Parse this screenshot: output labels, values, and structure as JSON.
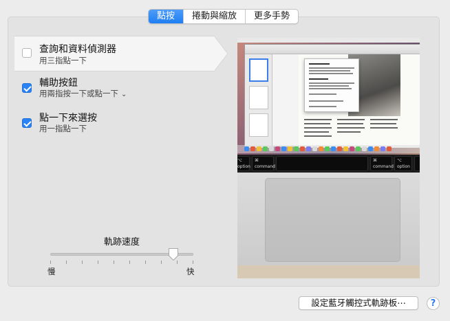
{
  "tabs": [
    {
      "label": "點按",
      "active": true
    },
    {
      "label": "捲動與縮放",
      "active": false
    },
    {
      "label": "更多手勢",
      "active": false
    }
  ],
  "options": [
    {
      "title": "查詢和資料偵測器",
      "subtitle": "用三指點一下",
      "checked": false,
      "selected": true
    },
    {
      "title": "輔助按鈕",
      "subtitle": "用兩指按一下或點一下",
      "checked": true,
      "selected": false,
      "has_dropdown": true
    },
    {
      "title": "點一下來選按",
      "subtitle": "用一指點一下",
      "checked": true,
      "selected": false
    }
  ],
  "tracking": {
    "label": "軌跡速度",
    "min_label": "慢",
    "max_label": "快",
    "value_fraction": 0.86,
    "ticks": 10
  },
  "preview": {
    "keyboard": {
      "left_key_symbol": "⌥",
      "left_key_label": "option",
      "command_symbol": "⌘",
      "command_label": "command",
      "right_command_symbol": "⌘",
      "right_command_label": "command",
      "right_option_symbol": "⌥",
      "right_option_label": "option"
    }
  },
  "footer": {
    "bluetooth_button": "設定藍牙觸控式軌跡板⋯",
    "help_label": "?"
  },
  "colors": {
    "accent": "#2a82f5",
    "background": "#ececec",
    "panel": "#e3e3e3"
  }
}
